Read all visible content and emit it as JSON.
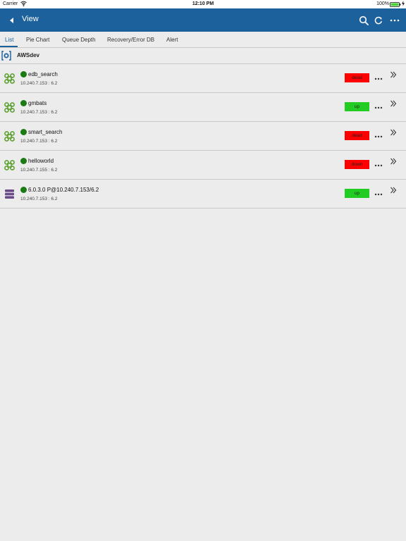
{
  "status_bar": {
    "carrier": "Carrier",
    "time": "12:10 PM",
    "battery": "100%"
  },
  "nav": {
    "back_icon": "chevron-left-icon",
    "title": "View",
    "actions": [
      "search-icon",
      "refresh-icon",
      "more-icon"
    ]
  },
  "tabs": [
    {
      "label": "List",
      "active": true
    },
    {
      "label": "Pie Chart",
      "active": false
    },
    {
      "label": "Queue Depth",
      "active": false
    },
    {
      "label": "Recovery/Error DB",
      "active": false
    },
    {
      "label": "Alert",
      "active": false
    }
  ],
  "group": {
    "icon": "server-group-icon",
    "name": "AWSdev"
  },
  "rows": [
    {
      "icon": "command-icon",
      "name": "edb_search",
      "address": "10.240.7.153 : 6.2",
      "status": "dead",
      "status_color": "#ff0000"
    },
    {
      "icon": "command-icon",
      "name": "gmbats",
      "address": "10.240.7.153 : 6.2",
      "status": "up",
      "status_color": "#22cc22"
    },
    {
      "icon": "command-icon",
      "name": "smart_search",
      "address": "10.240.7.153 : 6.2",
      "status": "dead",
      "status_color": "#ff0000"
    },
    {
      "icon": "command-icon",
      "name": "helloworld",
      "address": "10.240.7.155 : 6.2",
      "status": "down",
      "status_color": "#ff0000"
    },
    {
      "icon": "database-icon",
      "name": "6.0.3.0 P@10.240.7.153/6.2",
      "address": "10.240.7.153 : 6.2",
      "status": "up",
      "status_color": "#22cc22"
    }
  ],
  "colors": {
    "brand": "#1c619b",
    "online_dot": "#1a7a13",
    "command_icon": "#5aa02c",
    "database_icon": "#6b4a8a"
  }
}
